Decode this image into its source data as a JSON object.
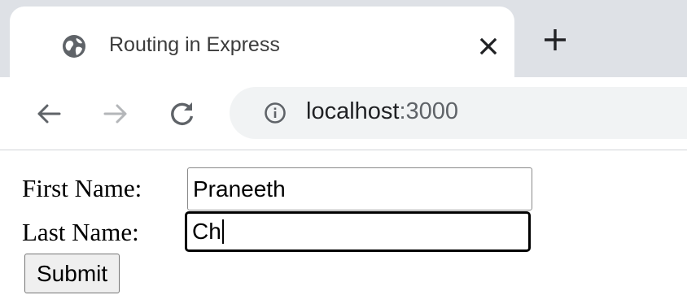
{
  "browser": {
    "tab": {
      "title": "Routing in Express",
      "favicon": "globe-icon",
      "close_icon": "close-icon"
    },
    "new_tab_icon": "plus-icon",
    "nav": {
      "back_icon": "arrow-left-icon",
      "forward_icon": "arrow-right-icon",
      "reload_icon": "reload-icon"
    },
    "address_bar": {
      "security_icon": "info-icon",
      "host": "localhost",
      "port": ":3000"
    }
  },
  "form": {
    "first_name_label": "First Name:",
    "first_name_value": "Praneeth",
    "last_name_label": "Last Name:",
    "last_name_value": "Ch",
    "submit_label": "Submit"
  },
  "colors": {
    "tabstrip_bg": "#dee1e6",
    "omnibox_bg": "#f1f3f4",
    "focus_border": "#000000"
  }
}
